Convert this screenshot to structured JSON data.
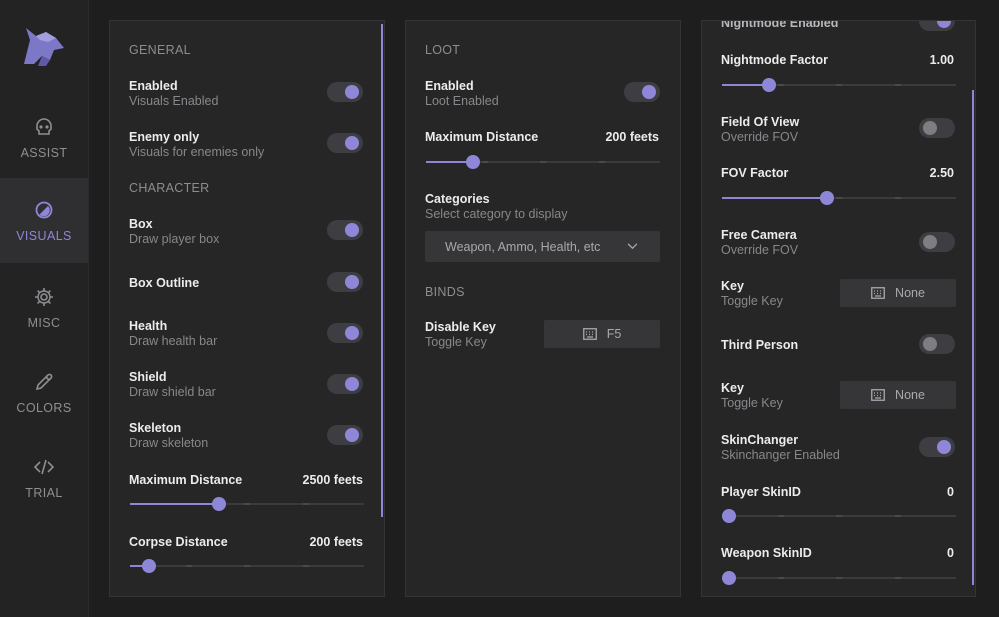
{
  "colors": {
    "accent": "#8e87d8",
    "background": "#1e1e1f",
    "panel": "#262627",
    "sidebar": "#232324"
  },
  "sidebar": {
    "items": [
      {
        "label": "ASSIST",
        "icon": "skull-icon",
        "active": false
      },
      {
        "label": "VISUALS",
        "icon": "visuals-icon",
        "active": true
      },
      {
        "label": "MISC",
        "icon": "gear-icon",
        "active": false
      },
      {
        "label": "COLORS",
        "icon": "eyedropper-icon",
        "active": false
      },
      {
        "label": "TRIAL",
        "icon": "code-icon",
        "active": false
      }
    ]
  },
  "general": {
    "section_general": "GENERAL",
    "enabled": {
      "label": "Enabled",
      "sub": "Visuals Enabled",
      "on": true
    },
    "enemy_only": {
      "label": "Enemy only",
      "sub": "Visuals for enemies only",
      "on": true
    },
    "section_character": "CHARACTER",
    "box": {
      "label": "Box",
      "sub": "Draw player box",
      "on": true
    },
    "box_outline": {
      "label": "Box Outline",
      "on": true
    },
    "health": {
      "label": "Health",
      "sub": "Draw health bar",
      "on": true
    },
    "shield": {
      "label": "Shield",
      "sub": "Draw shield bar",
      "on": true
    },
    "skeleton": {
      "label": "Skeleton",
      "sub": "Draw skeleton",
      "on": true
    },
    "max_distance": {
      "label": "Maximum Distance",
      "value": "2500 feets",
      "fraction": 0.38
    },
    "corpse_distance": {
      "label": "Corpse Distance",
      "value": "200 feets",
      "fraction": 0.08
    }
  },
  "loot": {
    "section_loot": "LOOT",
    "enabled": {
      "label": "Enabled",
      "sub": "Loot Enabled",
      "on": true
    },
    "max_distance": {
      "label": "Maximum Distance",
      "value": "200 feets",
      "fraction": 0.2
    },
    "categories": {
      "label": "Categories",
      "sub": "Select category to display",
      "selected": "Weapon, Ammo, Health, etc"
    },
    "section_binds": "BINDS",
    "disable_key": {
      "label": "Disable Key",
      "sub": "Toggle Key",
      "key": "F5"
    }
  },
  "misc": {
    "nightmode_enabled": {
      "label": "Nightmode Enabled",
      "on": true
    },
    "nightmode_factor": {
      "label": "Nightmode Factor",
      "value": "1.00",
      "fraction": 0.2
    },
    "fov": {
      "label": "Field Of View",
      "sub": "Override FOV",
      "on": false
    },
    "fov_factor": {
      "label": "FOV Factor",
      "value": "2.50",
      "fraction": 0.45
    },
    "free_camera": {
      "label": "Free Camera",
      "sub": "Override FOV",
      "on": false
    },
    "key1": {
      "label": "Key",
      "sub": "Toggle Key",
      "key": "None"
    },
    "third_person": {
      "label": "Third Person",
      "on": false
    },
    "key2": {
      "label": "Key",
      "sub": "Toggle Key",
      "key": "None"
    },
    "skinchanger": {
      "label": "SkinChanger",
      "sub": "Skinchanger Enabled",
      "on": true
    },
    "player_skin": {
      "label": "Player SkinID",
      "value": "0",
      "fraction": 0
    },
    "weapon_skin": {
      "label": "Weapon SkinID",
      "value": "0",
      "fraction": 0
    }
  }
}
